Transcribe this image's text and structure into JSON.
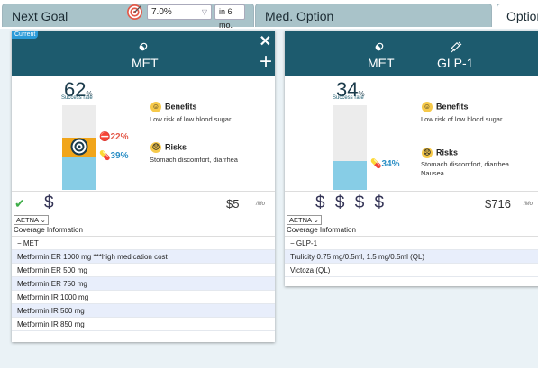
{
  "tabs": {
    "next_goal": "Next Goal",
    "goal_value": "7.0%",
    "goal_time": "in 6 mo.",
    "med_option": "Med. Option",
    "options": "Options"
  },
  "cards": [
    {
      "badge": "Current",
      "names": [
        "MET"
      ],
      "success_pct": "62",
      "pct_unit": "%",
      "success_label": "Success rate",
      "success_value": 0.62,
      "orange_label": "22%",
      "blue_label": "39%",
      "benefits_title": "Benefits",
      "benefits_text": "Low risk of low blood sugar",
      "risks_title": "Risks",
      "risks_text": "Stomach discomfort, diarrhea",
      "dollars": "$",
      "price": "$5",
      "per": "/Mo",
      "insurer": "AETNA",
      "coverage_label": "Coverage Information",
      "group": "− MET",
      "rows": [
        "Metformin ER 1000 mg ***high medication cost",
        "Metformin ER 500 mg",
        "Metformin ER 750 mg",
        "Metformin IR 1000 mg",
        "Metformin IR 500 mg",
        "Metformin IR 850 mg"
      ]
    },
    {
      "names": [
        "MET",
        "GLP-1"
      ],
      "success_pct": "34",
      "pct_unit": "%",
      "success_label": "Success rate",
      "success_value": 0.34,
      "blue_label": "34%",
      "benefits_title": "Benefits",
      "benefits_text": "Low risk of low blood sugar",
      "risks_title": "Risks",
      "risks_text": "Stomach discomfort, diarrhea\nNausea",
      "dollars": "$ $ $ $",
      "price": "$716",
      "per": "/Mo",
      "insurer": "AETNA",
      "coverage_label": "Coverage Information",
      "group": "− GLP-1",
      "rows": [
        "Trulicity 0.75 mg/0.5ml, 1.5 mg/0.5ml (QL)",
        "Victoza (QL)"
      ]
    }
  ],
  "colors": {
    "header": "#1d5b6e",
    "bar_blue": "#87cde6",
    "bar_orange": "#f1a51a"
  }
}
